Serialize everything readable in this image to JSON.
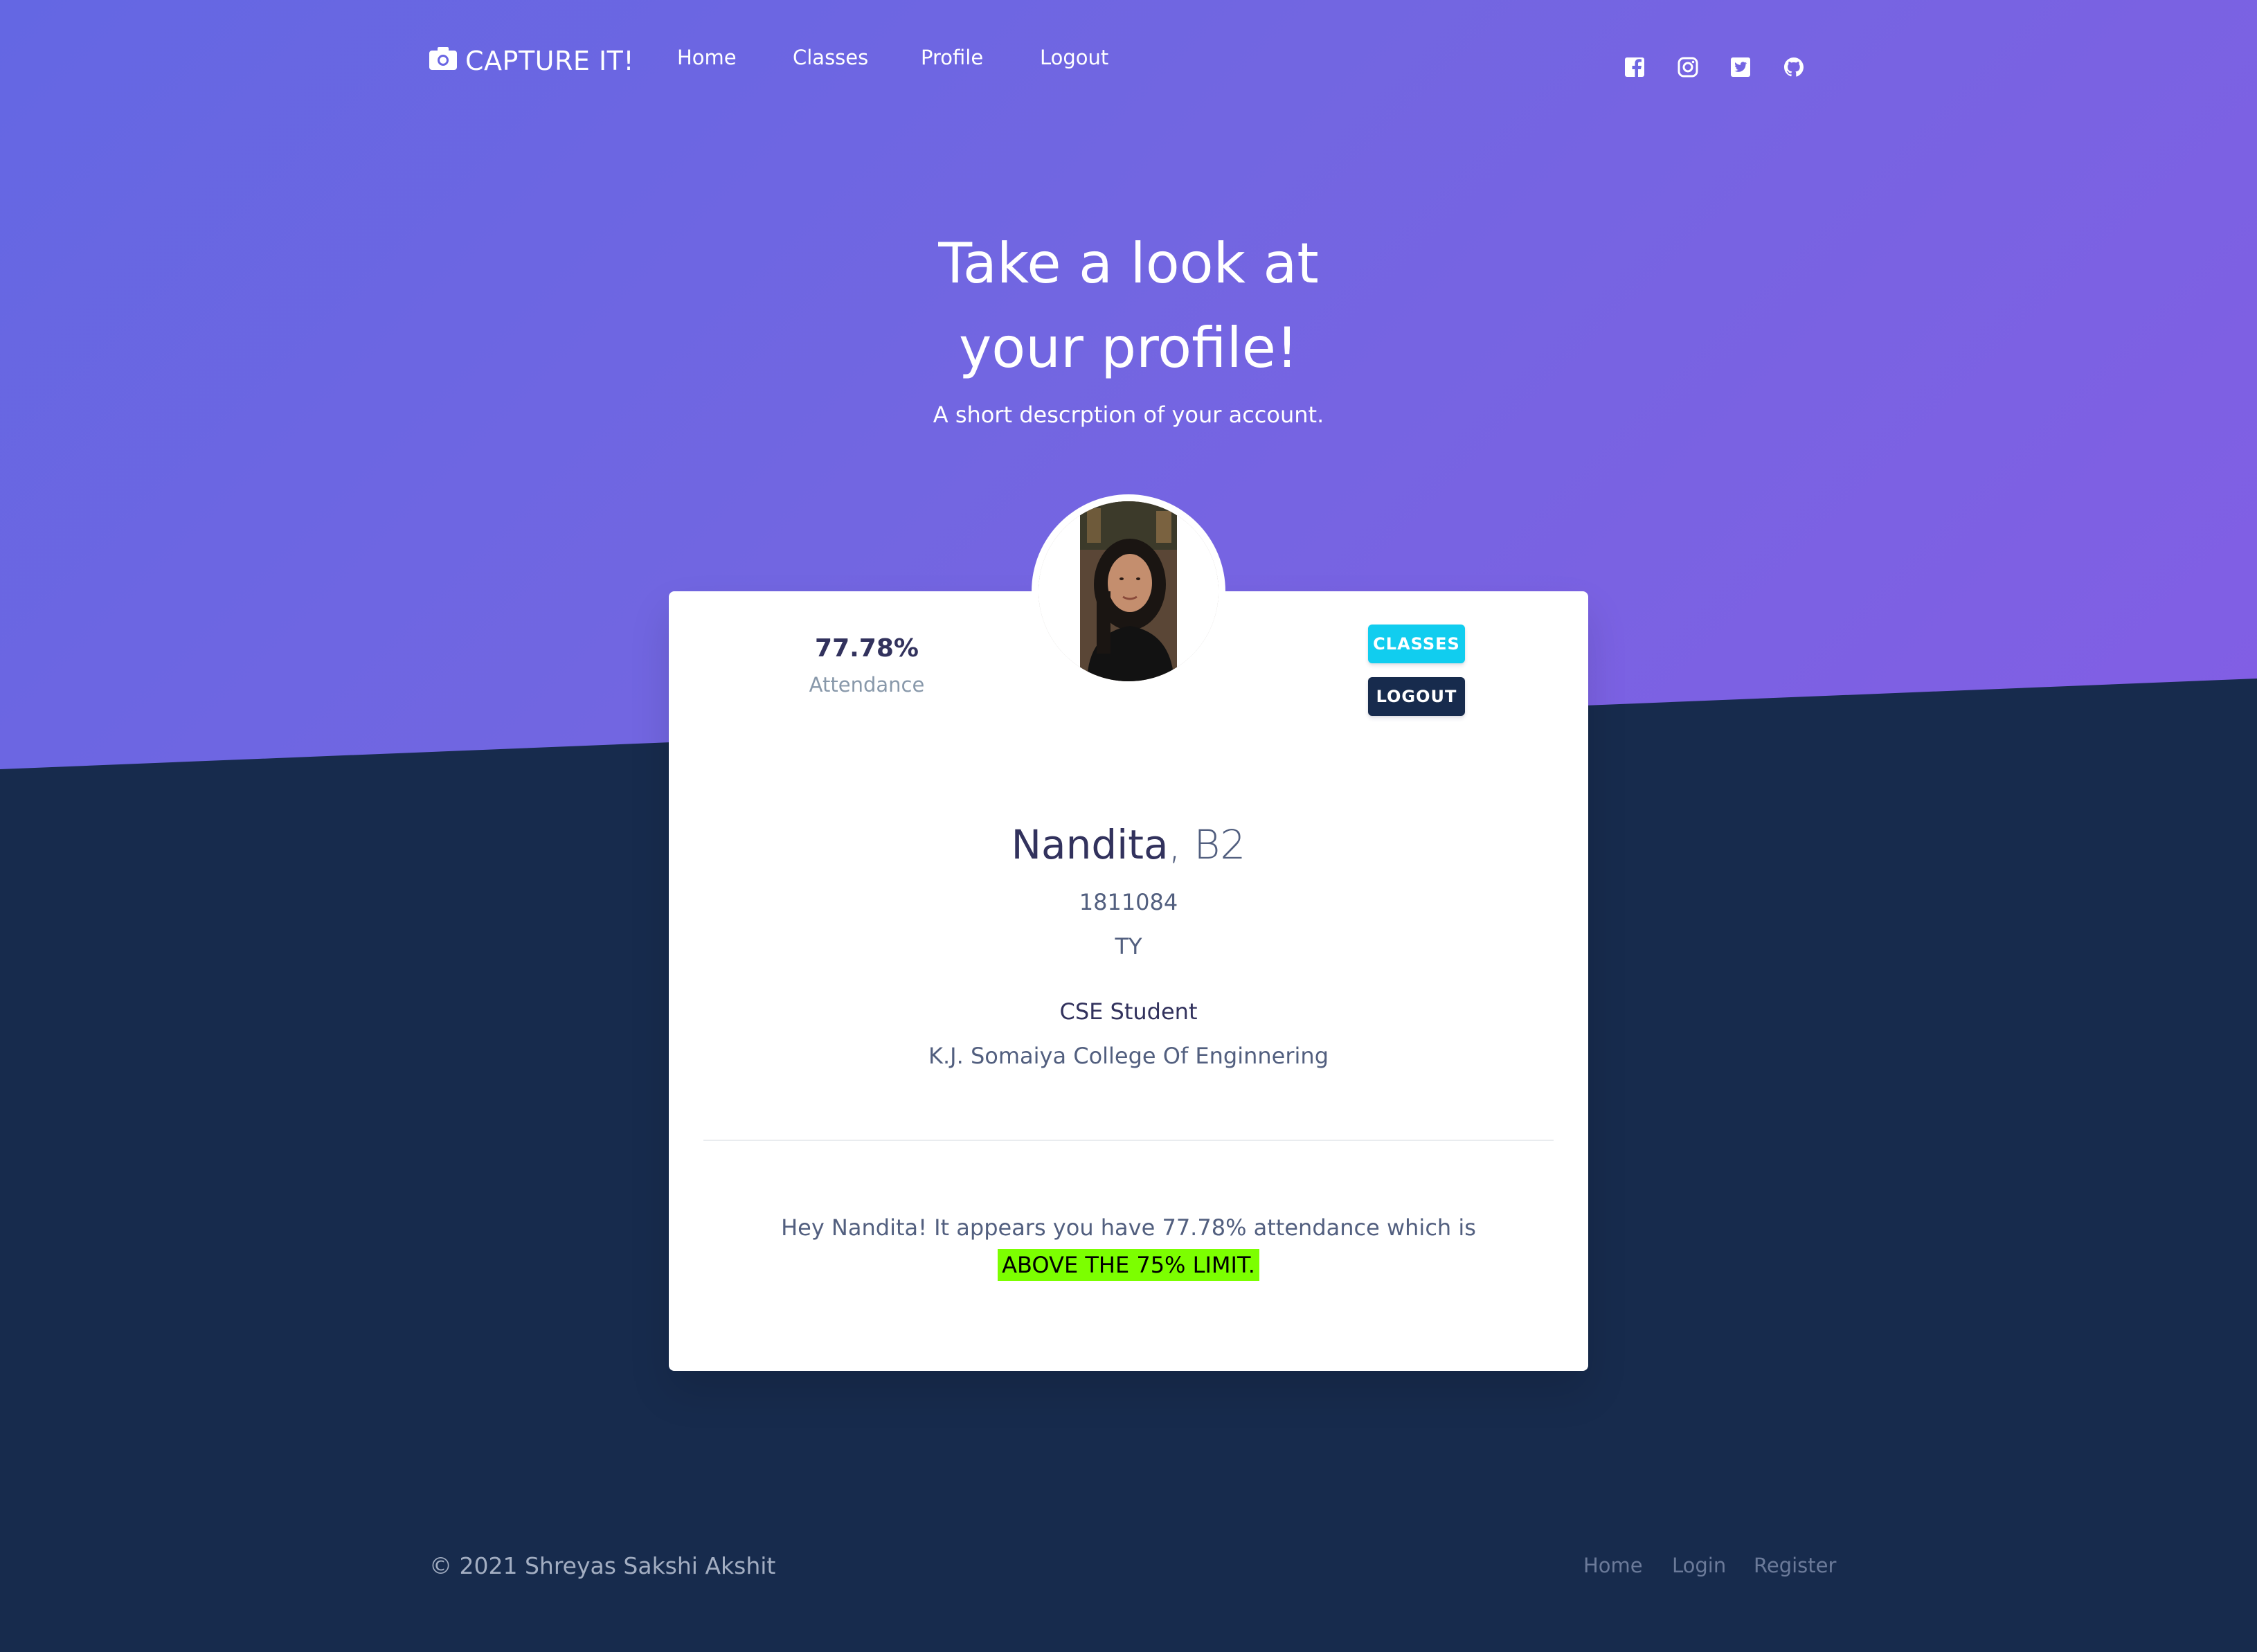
{
  "navbar": {
    "brand": "CAPTURE IT!",
    "links": [
      "Home",
      "Classes",
      "Profile",
      "Logout"
    ],
    "social_icons": [
      "facebook-icon",
      "instagram-icon",
      "twitter-icon",
      "github-icon"
    ]
  },
  "hero": {
    "title_line1": "Take a look at",
    "title_line2": "your profile!",
    "subtitle": "A short descrption of your account."
  },
  "profile_card": {
    "attendance_value": "77.78%",
    "attendance_label": "Attendance",
    "classes_button": "CLASSES",
    "logout_button": "LOGOUT",
    "name": "Nandita",
    "name_separator": ",",
    "division": " B2",
    "roll_number": "1811084",
    "year": "TY",
    "role": "CSE Student",
    "college": "K.J. Somaiya College Of Enginnering",
    "message": "Hey Nandita! It appears you have 77.78% attendance which is",
    "status_highlight": "ABOVE THE 75% LIMIT."
  },
  "footer": {
    "copyright": "© 2021 Shreyas Sakshi Akshit",
    "links": [
      "Home",
      "Login",
      "Register"
    ]
  },
  "colors": {
    "hero_gradient_start": "#6467e3",
    "hero_gradient_end": "#825ee4",
    "dark_background": "#172b4d",
    "classes_button": "#11cdef",
    "logout_button": "#172b4d",
    "highlight": "#7cff00"
  }
}
